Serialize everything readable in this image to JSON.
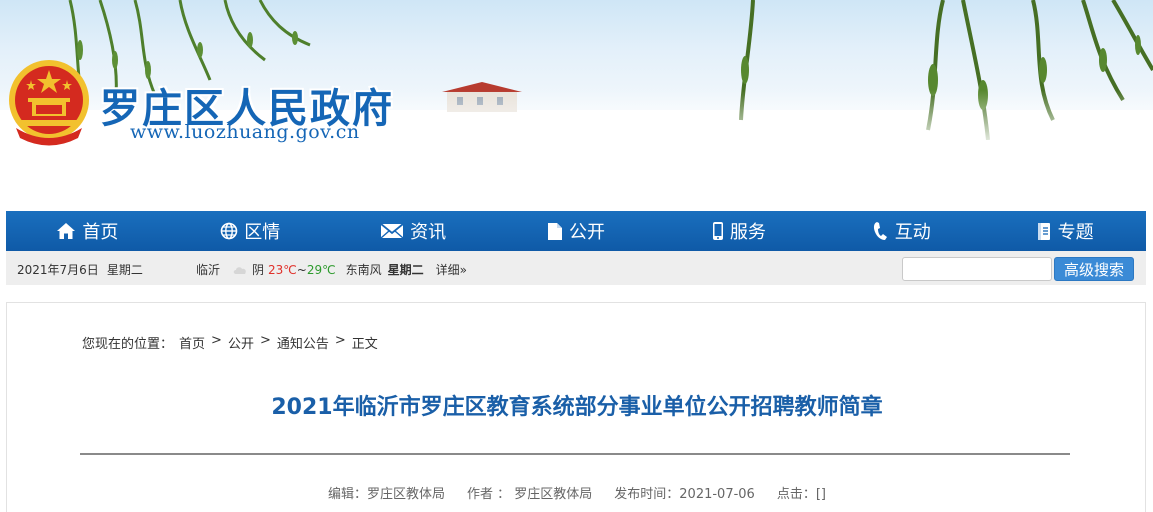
{
  "header": {
    "site_title": "罗庄区人民政府",
    "site_url": "www.luozhuang.gov.cn",
    "emblem_icon": "national-emblem-icon",
    "colors": {
      "brand": "#1566b6",
      "emblem_red": "#d42a1f",
      "emblem_gold": "#f2c12e"
    }
  },
  "nav": {
    "items": [
      {
        "label": "首页",
        "icon": "home-icon"
      },
      {
        "label": "区情",
        "icon": "globe-icon"
      },
      {
        "label": "资讯",
        "icon": "mail-icon"
      },
      {
        "label": "公开",
        "icon": "document-icon"
      },
      {
        "label": "服务",
        "icon": "phone-icon"
      },
      {
        "label": "互动",
        "icon": "handset-icon"
      },
      {
        "label": "专题",
        "icon": "book-icon"
      }
    ],
    "color": "#1566b6"
  },
  "infobar": {
    "date": "2021年7月6日",
    "weekday": "星期二",
    "weather": {
      "city": "临沂",
      "condition": "阴",
      "temp_high": "23℃",
      "temp_sep": "~",
      "temp_low": "29℃",
      "wind": "东南风",
      "day": "星期二",
      "detail_link": "详细»"
    },
    "search": {
      "placeholder": "",
      "button_label": "高级搜索"
    }
  },
  "breadcrumb": {
    "prefix": "您现在的位置：",
    "items": [
      "首页",
      "公开",
      "通知公告",
      "正文"
    ],
    "separator": ">"
  },
  "article": {
    "title": "2021年临沂市罗庄区教育系统部分事业单位公开招聘教师简章",
    "meta": {
      "editor": "编辑：罗庄区教体局",
      "author": "作者 ： 罗庄区教体局",
      "publish_time": "发布时间：2021-07-06",
      "clicks": "点击：[]"
    }
  }
}
